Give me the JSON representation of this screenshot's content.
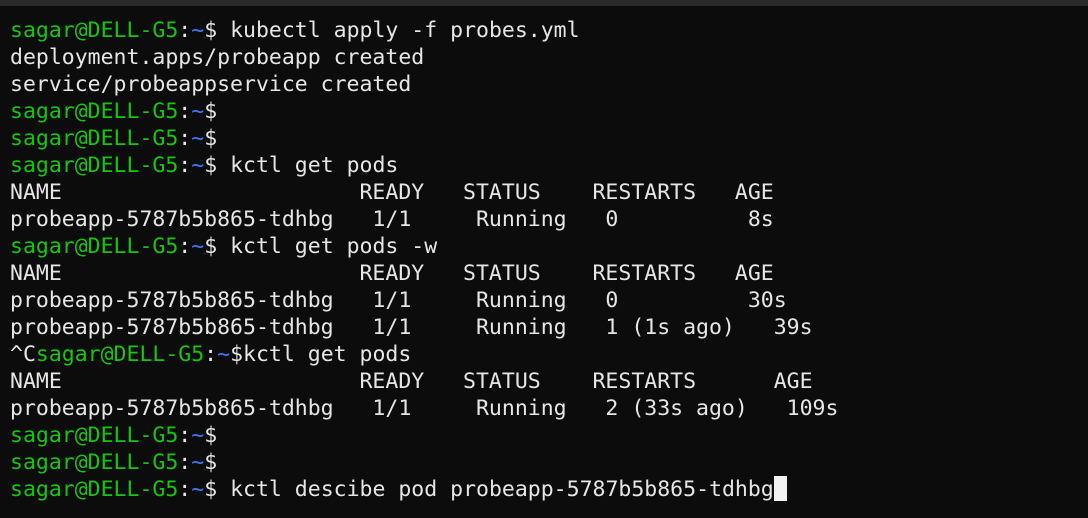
{
  "terminal": {
    "prompt_user": "sagar@DELL-G5",
    "prompt_sep": ":",
    "prompt_path": "~",
    "prompt_dollar": "$",
    "interrupt_prefix": "^C",
    "lines": [
      {
        "kind": "prompt",
        "cmd": " kubectl apply -f probes.yml"
      },
      {
        "kind": "output",
        "text": "deployment.apps/probeapp created"
      },
      {
        "kind": "output",
        "text": "service/probeappservice created"
      },
      {
        "kind": "prompt",
        "cmd": ""
      },
      {
        "kind": "prompt",
        "cmd": ""
      },
      {
        "kind": "prompt",
        "cmd": " kctl get pods"
      },
      {
        "kind": "output",
        "text": "NAME                       READY   STATUS    RESTARTS   AGE"
      },
      {
        "kind": "output",
        "text": "probeapp-5787b5b865-tdhbg   1/1     Running   0          8s"
      },
      {
        "kind": "prompt",
        "cmd": " kctl get pods -w"
      },
      {
        "kind": "output",
        "text": "NAME                       READY   STATUS    RESTARTS   AGE"
      },
      {
        "kind": "output",
        "text": "probeapp-5787b5b865-tdhbg   1/1     Running   0          30s"
      },
      {
        "kind": "output",
        "text": "probeapp-5787b5b865-tdhbg   1/1     Running   1 (1s ago)   39s"
      },
      {
        "kind": "interrupt-prompt",
        "cmd": "kctl get pods"
      },
      {
        "kind": "output",
        "text": "NAME                       READY   STATUS    RESTARTS      AGE"
      },
      {
        "kind": "output",
        "text": "probeapp-5787b5b865-tdhbg   1/1     Running   2 (33s ago)   109s"
      },
      {
        "kind": "prompt",
        "cmd": ""
      },
      {
        "kind": "prompt",
        "cmd": ""
      },
      {
        "kind": "prompt",
        "cmd": " kctl descibe pod probeapp-5787b5b865-tdhbg",
        "cursor": true
      }
    ]
  },
  "colors": {
    "background": "#0c0c0c",
    "user": "#16c60c",
    "path": "#3b78ff",
    "text": "#e6e6e6"
  }
}
